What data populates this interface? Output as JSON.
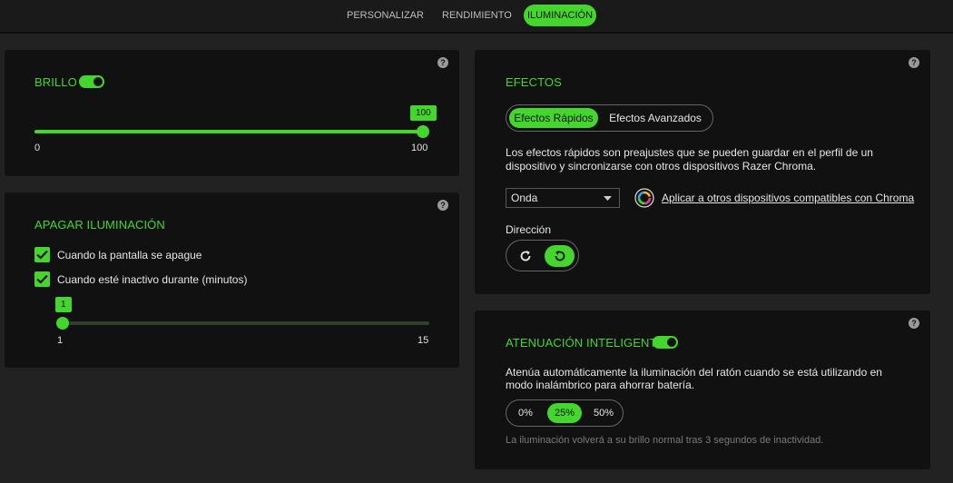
{
  "nav": {
    "tabs": [
      {
        "label": "PERSONALIZAR",
        "active": false
      },
      {
        "label": "RENDIMIENTO",
        "active": false
      },
      {
        "label": "ILUMINACIÓN",
        "active": true
      }
    ]
  },
  "brillo": {
    "title": "BRILLO",
    "help": "?",
    "toggle_on": true,
    "value": 100,
    "value_label": "100",
    "min_label": "0",
    "max_label": "100",
    "fraction": 1.0
  },
  "apagar": {
    "title": "APAGAR ILUMINACIÓN",
    "help": "?",
    "opt1": {
      "label": "Cuando la pantalla se apague",
      "checked": true
    },
    "opt2": {
      "label": "Cuando esté inactivo durante (minutos)",
      "checked": true
    },
    "value": 1,
    "value_label": "1",
    "min_label": "1",
    "max_label": "15",
    "fraction": 0.0
  },
  "efectos": {
    "title": "EFECTOS",
    "help": "?",
    "tabs": [
      {
        "label": "Efectos Rápidos",
        "active": true
      },
      {
        "label": "Efectos Avanzados",
        "active": false
      }
    ],
    "desc_line1": "Los efectos rápidos son preajustes que se pueden guardar en el perfil de un",
    "desc_line2": "dispositivo y sincronizarse con otros dispositivos Razer Chroma.",
    "select_value": "Onda",
    "apply_link": "Aplicar a otros dispositivos compatibles con Chroma",
    "direction_label": "Dirección",
    "direction_icons": [
      "rotate-clockwise-icon",
      "rotate-counterclockwise-icon"
    ],
    "direction_active": 1
  },
  "atenuacion": {
    "title": "ATENUACIÓN INTELIGENTE",
    "help": "?",
    "toggle_on": true,
    "desc_line1": "Atenúa automáticamente la iluminación del ratón cuando se está utilizando en",
    "desc_line2": "modo inalámbrico para ahorrar batería.",
    "options": [
      {
        "label": "0%",
        "active": false
      },
      {
        "label": "25%",
        "active": true
      },
      {
        "label": "50%",
        "active": false
      }
    ],
    "note": "La iluminación volverá a su brillo normal tras 3 segundos de inactividad."
  },
  "colors": {
    "accent": "#44d62c",
    "card": "#111111",
    "background": "#222222"
  }
}
